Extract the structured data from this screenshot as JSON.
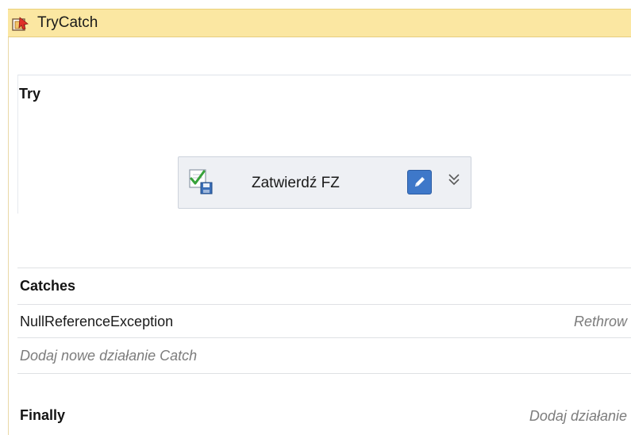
{
  "window": {
    "title": "TryCatch",
    "icon": "trycatch-activity-icon"
  },
  "try_section": {
    "label": "Try",
    "activity": {
      "label": "Zatwierdź FZ",
      "icon": "approve-save-icon",
      "edit_icon": "pencil-icon",
      "expand_icon": "double-chevron-down-icon"
    }
  },
  "catches_section": {
    "label": "Catches",
    "items": [
      {
        "exception": "NullReferenceException",
        "action": "Rethrow"
      }
    ],
    "add_placeholder": "Dodaj nowe działanie Catch"
  },
  "finally_section": {
    "label": "Finally",
    "add_action": "Dodaj działanie"
  },
  "colors": {
    "titlebar": "#fbe7a2",
    "activity_bg": "#eef0f4",
    "edit_button": "#3e78c9",
    "placeholder_text": "#7c7c7c"
  }
}
